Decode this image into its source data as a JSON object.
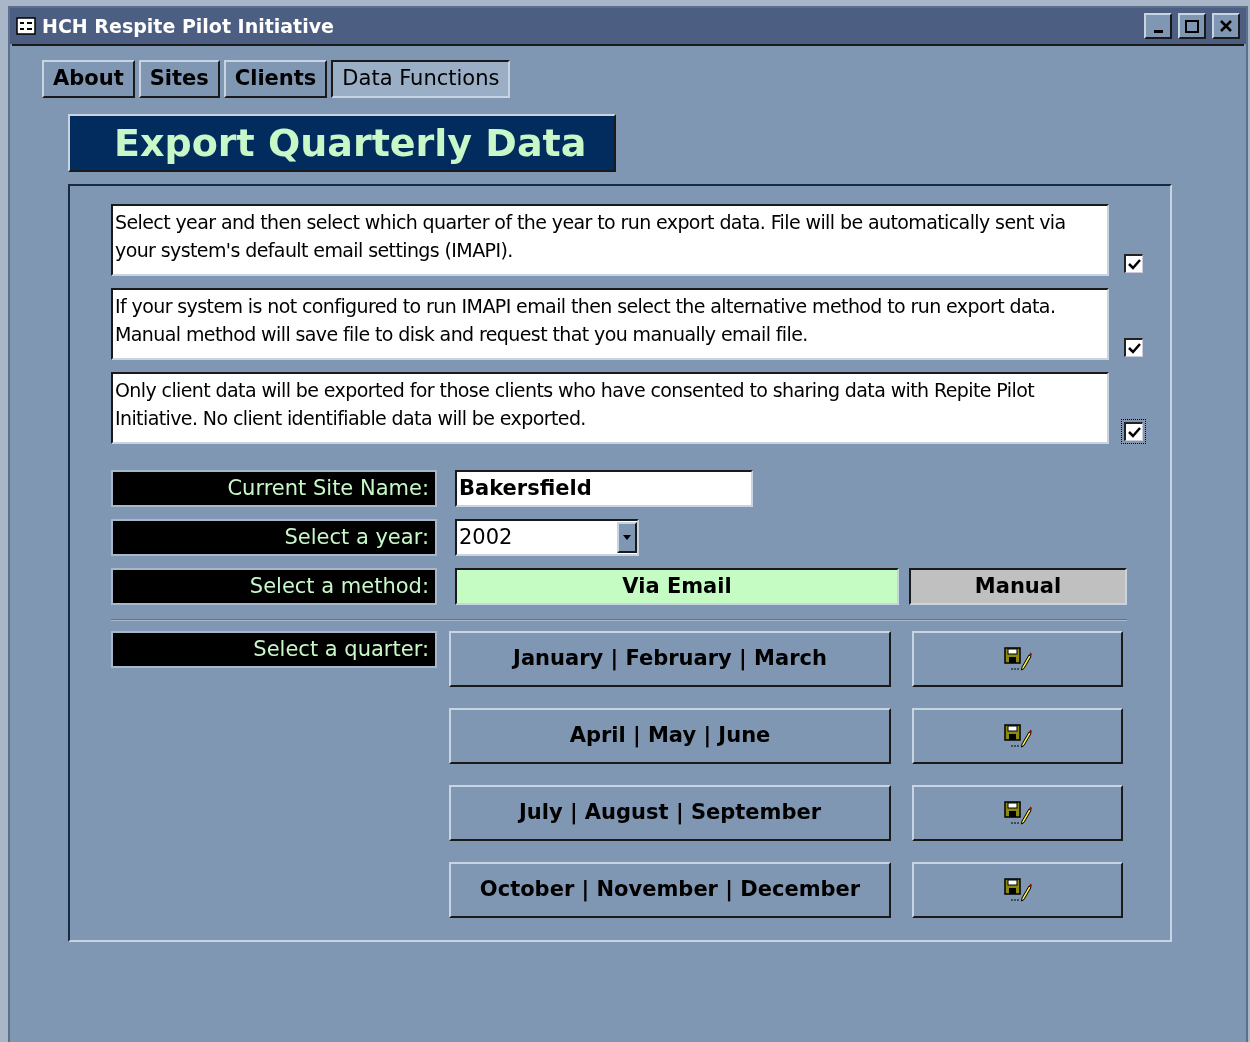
{
  "window": {
    "title": "HCH Respite Pilot Initiative"
  },
  "tabs": [
    {
      "label": "About",
      "selected": false
    },
    {
      "label": "Sites",
      "selected": false
    },
    {
      "label": "Clients",
      "selected": false
    },
    {
      "label": "Data Functions",
      "selected": true
    }
  ],
  "heading": "Export Quarterly Data",
  "notes": [
    {
      "text": "Select year and then select which quarter of the year to run export data. File will be automatically sent via your system's default email settings (IMAPI).",
      "checked": true,
      "focused": false
    },
    {
      "text": "If your system is not configured to run IMAPI email then select the alternative method to run export data. Manual method will save file to disk and request that you manually email file.",
      "checked": true,
      "focused": false
    },
    {
      "text": "Only client data will be exported for those clients who have consented to sharing data with Repite Pilot Initiative. No client identifiable data will be exported.",
      "checked": true,
      "focused": true
    }
  ],
  "site": {
    "label": "Current Site Name:",
    "value": "Bakersfield"
  },
  "year": {
    "label": "Select a year:",
    "value": "2002"
  },
  "method": {
    "label": "Select a method:",
    "options": [
      {
        "label": "Via Email",
        "selected": true
      },
      {
        "label": "Manual",
        "selected": false
      }
    ]
  },
  "quarter": {
    "label": "Select a quarter:",
    "buttons": [
      "January | February | March",
      "April | May | June",
      "July | August | September",
      "October | November | December"
    ]
  }
}
